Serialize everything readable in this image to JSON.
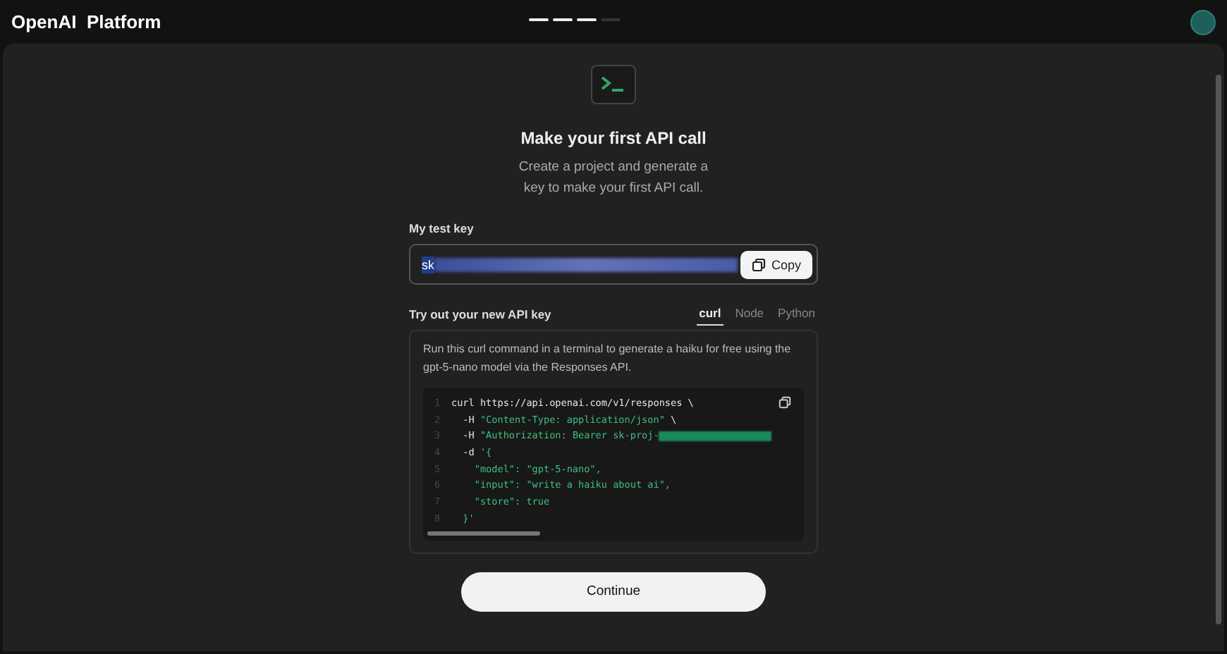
{
  "header": {
    "brand": "OpenAI  Platform"
  },
  "progress": [
    {
      "done": true
    },
    {
      "done": true
    },
    {
      "done": true
    },
    {
      "done": false
    }
  ],
  "title": "Make your first API call",
  "subtitle": "Create a project and generate a key to make your first API call.",
  "key": {
    "label": "My test key",
    "value": "sk",
    "redacted": true,
    "copy": "Copy"
  },
  "try": {
    "label": "Try out your new API key",
    "tabs": [
      {
        "label": "curl",
        "selected": true
      },
      {
        "label": "Node",
        "selected": false
      },
      {
        "label": "Python",
        "selected": false
      }
    ],
    "description": "Run this curl command in a terminal to generate a haiku for free using the gpt-5-nano model via the Responses API.",
    "code": [
      {
        "number": "1",
        "segments": [
          {
            "text": "curl https://api.openai.com/v1/responses \\",
            "kind": "plain"
          }
        ]
      },
      {
        "number": "2",
        "segments": [
          {
            "text": "  -H ",
            "kind": "plain"
          },
          {
            "text": "\"Content-Type: application/json\"",
            "kind": "string"
          },
          {
            "text": " \\",
            "kind": "plain"
          }
        ]
      },
      {
        "number": "3",
        "segments": [
          {
            "text": "  -H ",
            "kind": "plain"
          },
          {
            "text": "\"Authorization: Bearer sk-proj-",
            "kind": "string"
          }
        ],
        "redacted": true
      },
      {
        "number": "4",
        "segments": [
          {
            "text": "  -d ",
            "kind": "plain"
          },
          {
            "text": "'{",
            "kind": "string"
          }
        ]
      },
      {
        "number": "5",
        "segments": [
          {
            "text": "    \"model\": \"gpt-5-nano\",",
            "kind": "string"
          }
        ]
      },
      {
        "number": "6",
        "segments": [
          {
            "text": "    \"input\": \"write a haiku about ai\",",
            "kind": "string"
          }
        ]
      },
      {
        "number": "7",
        "segments": [
          {
            "text": "    \"store\": true",
            "kind": "string"
          }
        ]
      },
      {
        "number": "8",
        "segments": [
          {
            "text": "  }'",
            "kind": "string"
          }
        ]
      }
    ]
  },
  "continue": "Continue"
}
